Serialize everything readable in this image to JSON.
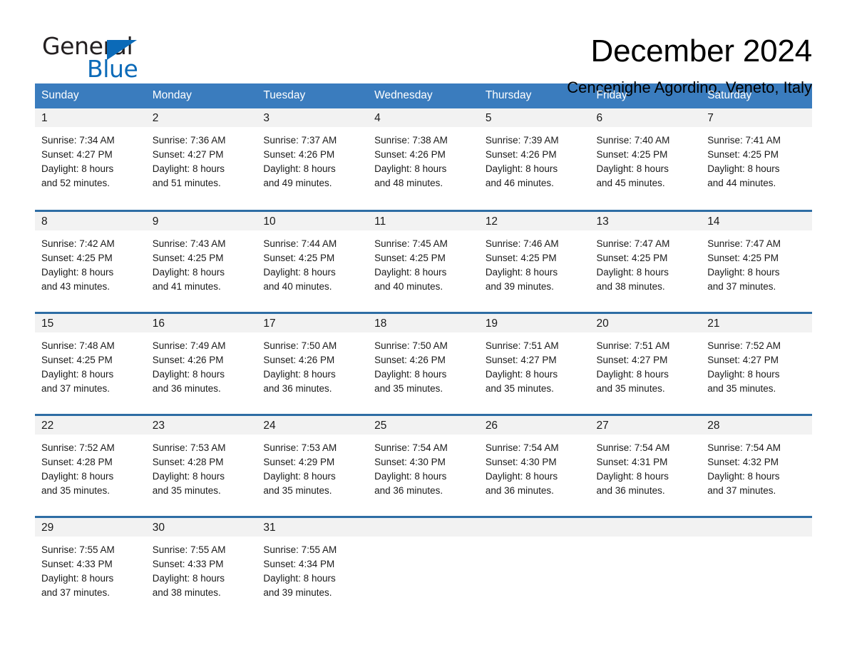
{
  "brand": {
    "name_part1": "General",
    "name_part2": "Blue",
    "accent_color": "#0b6ab8"
  },
  "header": {
    "title": "December 2024",
    "location": "Cencenighe Agordino, Veneto, Italy"
  },
  "theme": {
    "header_blue": "#3a7cbe",
    "row_divider_blue": "#2e6da4",
    "daynum_band": "#f2f2f2"
  },
  "calendar": {
    "weekday_headers": [
      "Sunday",
      "Monday",
      "Tuesday",
      "Wednesday",
      "Thursday",
      "Friday",
      "Saturday"
    ],
    "weeks": [
      [
        {
          "day": "1",
          "sunrise": "Sunrise: 7:34 AM",
          "sunset": "Sunset: 4:27 PM",
          "daylight_line1": "Daylight: 8 hours",
          "daylight_line2": "and 52 minutes."
        },
        {
          "day": "2",
          "sunrise": "Sunrise: 7:36 AM",
          "sunset": "Sunset: 4:27 PM",
          "daylight_line1": "Daylight: 8 hours",
          "daylight_line2": "and 51 minutes."
        },
        {
          "day": "3",
          "sunrise": "Sunrise: 7:37 AM",
          "sunset": "Sunset: 4:26 PM",
          "daylight_line1": "Daylight: 8 hours",
          "daylight_line2": "and 49 minutes."
        },
        {
          "day": "4",
          "sunrise": "Sunrise: 7:38 AM",
          "sunset": "Sunset: 4:26 PM",
          "daylight_line1": "Daylight: 8 hours",
          "daylight_line2": "and 48 minutes."
        },
        {
          "day": "5",
          "sunrise": "Sunrise: 7:39 AM",
          "sunset": "Sunset: 4:26 PM",
          "daylight_line1": "Daylight: 8 hours",
          "daylight_line2": "and 46 minutes."
        },
        {
          "day": "6",
          "sunrise": "Sunrise: 7:40 AM",
          "sunset": "Sunset: 4:25 PM",
          "daylight_line1": "Daylight: 8 hours",
          "daylight_line2": "and 45 minutes."
        },
        {
          "day": "7",
          "sunrise": "Sunrise: 7:41 AM",
          "sunset": "Sunset: 4:25 PM",
          "daylight_line1": "Daylight: 8 hours",
          "daylight_line2": "and 44 minutes."
        }
      ],
      [
        {
          "day": "8",
          "sunrise": "Sunrise: 7:42 AM",
          "sunset": "Sunset: 4:25 PM",
          "daylight_line1": "Daylight: 8 hours",
          "daylight_line2": "and 43 minutes."
        },
        {
          "day": "9",
          "sunrise": "Sunrise: 7:43 AM",
          "sunset": "Sunset: 4:25 PM",
          "daylight_line1": "Daylight: 8 hours",
          "daylight_line2": "and 41 minutes."
        },
        {
          "day": "10",
          "sunrise": "Sunrise: 7:44 AM",
          "sunset": "Sunset: 4:25 PM",
          "daylight_line1": "Daylight: 8 hours",
          "daylight_line2": "and 40 minutes."
        },
        {
          "day": "11",
          "sunrise": "Sunrise: 7:45 AM",
          "sunset": "Sunset: 4:25 PM",
          "daylight_line1": "Daylight: 8 hours",
          "daylight_line2": "and 40 minutes."
        },
        {
          "day": "12",
          "sunrise": "Sunrise: 7:46 AM",
          "sunset": "Sunset: 4:25 PM",
          "daylight_line1": "Daylight: 8 hours",
          "daylight_line2": "and 39 minutes."
        },
        {
          "day": "13",
          "sunrise": "Sunrise: 7:47 AM",
          "sunset": "Sunset: 4:25 PM",
          "daylight_line1": "Daylight: 8 hours",
          "daylight_line2": "and 38 minutes."
        },
        {
          "day": "14",
          "sunrise": "Sunrise: 7:47 AM",
          "sunset": "Sunset: 4:25 PM",
          "daylight_line1": "Daylight: 8 hours",
          "daylight_line2": "and 37 minutes."
        }
      ],
      [
        {
          "day": "15",
          "sunrise": "Sunrise: 7:48 AM",
          "sunset": "Sunset: 4:25 PM",
          "daylight_line1": "Daylight: 8 hours",
          "daylight_line2": "and 37 minutes."
        },
        {
          "day": "16",
          "sunrise": "Sunrise: 7:49 AM",
          "sunset": "Sunset: 4:26 PM",
          "daylight_line1": "Daylight: 8 hours",
          "daylight_line2": "and 36 minutes."
        },
        {
          "day": "17",
          "sunrise": "Sunrise: 7:50 AM",
          "sunset": "Sunset: 4:26 PM",
          "daylight_line1": "Daylight: 8 hours",
          "daylight_line2": "and 36 minutes."
        },
        {
          "day": "18",
          "sunrise": "Sunrise: 7:50 AM",
          "sunset": "Sunset: 4:26 PM",
          "daylight_line1": "Daylight: 8 hours",
          "daylight_line2": "and 35 minutes."
        },
        {
          "day": "19",
          "sunrise": "Sunrise: 7:51 AM",
          "sunset": "Sunset: 4:27 PM",
          "daylight_line1": "Daylight: 8 hours",
          "daylight_line2": "and 35 minutes."
        },
        {
          "day": "20",
          "sunrise": "Sunrise: 7:51 AM",
          "sunset": "Sunset: 4:27 PM",
          "daylight_line1": "Daylight: 8 hours",
          "daylight_line2": "and 35 minutes."
        },
        {
          "day": "21",
          "sunrise": "Sunrise: 7:52 AM",
          "sunset": "Sunset: 4:27 PM",
          "daylight_line1": "Daylight: 8 hours",
          "daylight_line2": "and 35 minutes."
        }
      ],
      [
        {
          "day": "22",
          "sunrise": "Sunrise: 7:52 AM",
          "sunset": "Sunset: 4:28 PM",
          "daylight_line1": "Daylight: 8 hours",
          "daylight_line2": "and 35 minutes."
        },
        {
          "day": "23",
          "sunrise": "Sunrise: 7:53 AM",
          "sunset": "Sunset: 4:28 PM",
          "daylight_line1": "Daylight: 8 hours",
          "daylight_line2": "and 35 minutes."
        },
        {
          "day": "24",
          "sunrise": "Sunrise: 7:53 AM",
          "sunset": "Sunset: 4:29 PM",
          "daylight_line1": "Daylight: 8 hours",
          "daylight_line2": "and 35 minutes."
        },
        {
          "day": "25",
          "sunrise": "Sunrise: 7:54 AM",
          "sunset": "Sunset: 4:30 PM",
          "daylight_line1": "Daylight: 8 hours",
          "daylight_line2": "and 36 minutes."
        },
        {
          "day": "26",
          "sunrise": "Sunrise: 7:54 AM",
          "sunset": "Sunset: 4:30 PM",
          "daylight_line1": "Daylight: 8 hours",
          "daylight_line2": "and 36 minutes."
        },
        {
          "day": "27",
          "sunrise": "Sunrise: 7:54 AM",
          "sunset": "Sunset: 4:31 PM",
          "daylight_line1": "Daylight: 8 hours",
          "daylight_line2": "and 36 minutes."
        },
        {
          "day": "28",
          "sunrise": "Sunrise: 7:54 AM",
          "sunset": "Sunset: 4:32 PM",
          "daylight_line1": "Daylight: 8 hours",
          "daylight_line2": "and 37 minutes."
        }
      ],
      [
        {
          "day": "29",
          "sunrise": "Sunrise: 7:55 AM",
          "sunset": "Sunset: 4:33 PM",
          "daylight_line1": "Daylight: 8 hours",
          "daylight_line2": "and 37 minutes."
        },
        {
          "day": "30",
          "sunrise": "Sunrise: 7:55 AM",
          "sunset": "Sunset: 4:33 PM",
          "daylight_line1": "Daylight: 8 hours",
          "daylight_line2": "and 38 minutes."
        },
        {
          "day": "31",
          "sunrise": "Sunrise: 7:55 AM",
          "sunset": "Sunset: 4:34 PM",
          "daylight_line1": "Daylight: 8 hours",
          "daylight_line2": "and 39 minutes."
        },
        {
          "day": "",
          "sunrise": "",
          "sunset": "",
          "daylight_line1": "",
          "daylight_line2": ""
        },
        {
          "day": "",
          "sunrise": "",
          "sunset": "",
          "daylight_line1": "",
          "daylight_line2": ""
        },
        {
          "day": "",
          "sunrise": "",
          "sunset": "",
          "daylight_line1": "",
          "daylight_line2": ""
        },
        {
          "day": "",
          "sunrise": "",
          "sunset": "",
          "daylight_line1": "",
          "daylight_line2": ""
        }
      ]
    ]
  }
}
